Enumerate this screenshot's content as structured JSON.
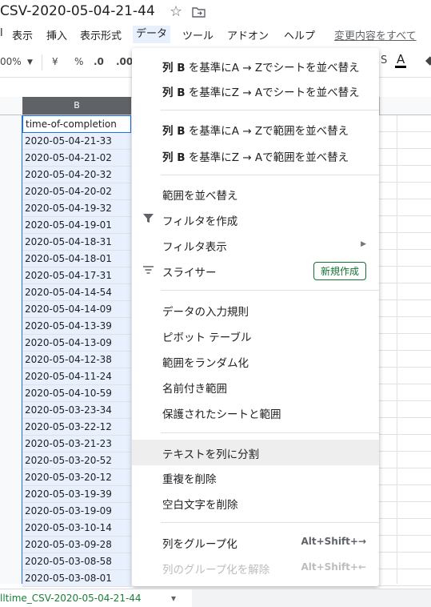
{
  "title": {
    "doc_name": "CSV-2020-05-04-21-44"
  },
  "menubar": {
    "items": [
      "表示",
      "挿入",
      "表示形式",
      "データ",
      "ツール",
      "アドオン",
      "ヘルプ"
    ],
    "changes_link": "変更内容をすべて"
  },
  "toolbar": {
    "zoom": "00%",
    "currency": "¥",
    "percent": "%",
    "dec_decrease": ".0",
    "dec_increase": ".00"
  },
  "columns": {
    "selected_header": "B"
  },
  "cells": [
    "time-of-completion",
    "2020-05-04-21-33",
    "2020-05-04-21-02",
    "2020-05-04-20-32",
    "2020-05-04-20-02",
    "2020-05-04-19-32",
    "2020-05-04-19-01",
    "2020-05-04-18-31",
    "2020-05-04-18-01",
    "2020-05-04-17-31",
    "2020-05-04-14-54",
    "2020-05-04-14-09",
    "2020-05-04-13-39",
    "2020-05-04-13-09",
    "2020-05-04-12-38",
    "2020-05-04-11-24",
    "2020-05-04-10-59",
    "2020-05-03-23-34",
    "2020-05-03-22-12",
    "2020-05-03-21-23",
    "2020-05-03-20-52",
    "2020-05-03-20-12",
    "2020-05-03-19-39",
    "2020-05-03-19-09",
    "2020-05-03-10-14",
    "2020-05-03-09-28",
    "2020-05-03-08-58",
    "2020-05-03-08-01"
  ],
  "menu": {
    "sort_sheet_az_bold": "列 B",
    "sort_sheet_az_rest": " を基準にA → Zでシートを並べ替え",
    "sort_sheet_za_bold": "列 B",
    "sort_sheet_za_rest": " を基準にZ → Aでシートを並べ替え",
    "sort_range_az_bold": "列 B",
    "sort_range_az_rest": " を基準にA → Zで範囲を並べ替え",
    "sort_range_za_bold": "列 B",
    "sort_range_za_rest": " を基準にZ → Aで範囲を並べ替え",
    "sort_range": "範囲を並べ替え",
    "create_filter": "フィルタを作成",
    "filter_views": "フィルタ表示",
    "slicer": "スライサー",
    "slicer_badge": "新規作成",
    "data_validation": "データの入力規則",
    "pivot_table": "ピボット テーブル",
    "randomize_range": "範囲をランダム化",
    "named_ranges": "名前付き範囲",
    "protected_sheets": "保護されたシートと範囲",
    "split_text": "テキストを列に分割",
    "remove_duplicates": "重複を削除",
    "trim_whitespace": "空白文字を削除",
    "group_columns": "列をグループ化",
    "group_columns_shortcut": "Alt+Shift+→",
    "ungroup_columns": "列のグループ化を解除",
    "ungroup_columns_shortcut": "Alt+Shift+←"
  },
  "sheet_tab": {
    "label": "lltime_CSV-2020-05-04-21-44"
  }
}
